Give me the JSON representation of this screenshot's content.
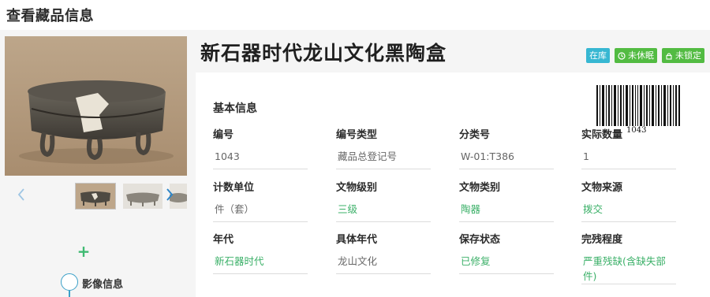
{
  "page": {
    "title": "查看藏品信息"
  },
  "item": {
    "title": "新石器时代龙山文化黑陶盒"
  },
  "badges": [
    {
      "label": "在库",
      "color": "#37b7d2"
    },
    {
      "label": "未休眠",
      "color": "#52bb42",
      "icon": "clock-icon"
    },
    {
      "label": "未锁定",
      "color": "#52bb42",
      "icon": "lock-icon"
    }
  ],
  "section": {
    "basic_info": "基本信息"
  },
  "barcode": {
    "number": "1043"
  },
  "fields": [
    {
      "label": "编号",
      "value": "1043"
    },
    {
      "label": "编号类型",
      "value": "藏品总登记号"
    },
    {
      "label": "分类号",
      "value": "W-01:T386"
    },
    {
      "label": "实际数量",
      "value": "1"
    },
    {
      "label": "计数单位",
      "value": "件（套）"
    },
    {
      "label": "文物级别",
      "value": "三级"
    },
    {
      "label": "文物类别",
      "value": "陶器"
    },
    {
      "label": "文物来源",
      "value": "拨交"
    },
    {
      "label": "年代",
      "value": "新石器时代"
    },
    {
      "label": "具体年代",
      "value": "龙山文化"
    },
    {
      "label": "保存状态",
      "value": "已修复"
    },
    {
      "label": "完残程度",
      "value": "严重残缺(含缺失部件)"
    }
  ],
  "timeline": {
    "node_label": "影像信息"
  },
  "colors": {
    "accent_blue": "#37b7d2",
    "accent_green": "#52bb42",
    "link_green": "#3bb068"
  }
}
